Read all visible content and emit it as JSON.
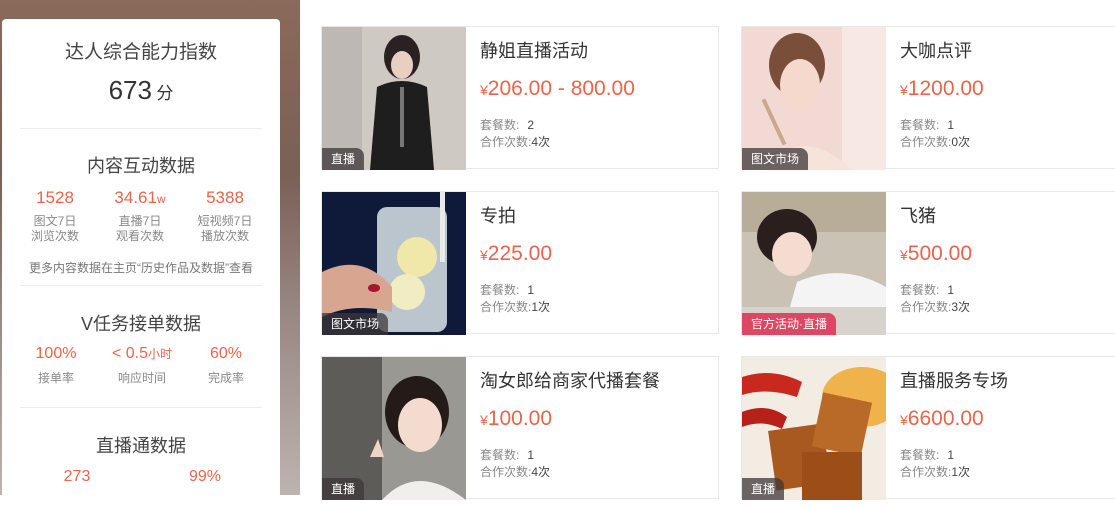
{
  "sidebar": {
    "score_title": "达人综合能力指数",
    "score_value": "673",
    "score_unit": "分",
    "content": {
      "title": "内容互动数据",
      "stats": [
        {
          "value": "1528",
          "unit": "",
          "label1": "图文7日",
          "label2": "浏览次数"
        },
        {
          "value": "34.61",
          "unit": "w",
          "label1": "直播7日",
          "label2": "观看次数"
        },
        {
          "value": "5388",
          "unit": "",
          "label1": "短视频7日",
          "label2": "播放次数"
        }
      ],
      "note": "更多内容数据在主页“历史作品及数据”查看"
    },
    "vtask": {
      "title": "V任务接单数据",
      "stats": [
        {
          "value": "100%",
          "unit": "",
          "label": "接单率"
        },
        {
          "value": "< 0.5",
          "unit": "小时",
          "label": "响应时间"
        },
        {
          "value": "60%",
          "unit": "",
          "label": "完成率"
        }
      ]
    },
    "live": {
      "title": "直播通数据",
      "stats": [
        {
          "value": "273"
        },
        {
          "value": "99%"
        }
      ]
    }
  },
  "labels": {
    "currency": "¥",
    "packages": "套餐数:",
    "cooperations": "合作次数:"
  },
  "cards": [
    {
      "title": "静姐直播活动",
      "price": "206.00 - 800.00",
      "packages": "2",
      "coop": "4次",
      "tag": "直播"
    },
    {
      "title": "大咖点评",
      "price": "1200.00",
      "packages": "1",
      "coop": "0次",
      "tag": "图文市场"
    },
    {
      "title": "专拍",
      "price": "225.00",
      "packages": "1",
      "coop": "1次",
      "tag": "图文市场"
    },
    {
      "title": "飞猪",
      "price": "500.00",
      "packages": "1",
      "coop": "3次",
      "tag": "官方活动·直播"
    },
    {
      "title": "淘女郎给商家代播套餐",
      "price": "100.00",
      "packages": "1",
      "coop": "4次",
      "tag": "直播"
    },
    {
      "title": "直播服务专场",
      "price": "6600.00",
      "packages": "1",
      "coop": "1次",
      "tag": "直播"
    }
  ]
}
